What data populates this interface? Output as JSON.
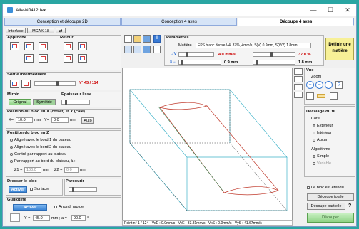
{
  "window": {
    "title": "Aile-NJ412.fex",
    "controls": [
      "—",
      "☐",
      "✕"
    ]
  },
  "tabs": [
    "Conception et découpe 2D",
    "Conception 4 axes",
    "Découpe 4 axes"
  ],
  "interface": {
    "label": "Interface",
    "machine": "MCAX-18"
  },
  "approche": {
    "title": "Approche"
  },
  "retour": {
    "title": "Retour"
  },
  "sortie": {
    "title": "Sortie intermédiaire",
    "value": "N° 45 / 114"
  },
  "miroir": {
    "title": "Miroir",
    "original": "Original",
    "symetrie": "Symétrie"
  },
  "epaisseur": {
    "title": "Épaisseur lisse"
  },
  "position_xy": {
    "title": "Position du bloc en X (offset) et Y (cale)",
    "x_label": "X=",
    "x_value": "10.0",
    "x_unit": "mm",
    "y_label": "Y=",
    "y_value": "0.0",
    "y_unit": "mm",
    "auto": "Auto"
  },
  "position_z": {
    "title": "Position du bloc en Z",
    "options": [
      "Aligné avec le bord 1 du plateau",
      "Aligné avec le bord 2 du plateau",
      "Centré par rapport au plateau",
      "Par rapport au bord du plateau, à :"
    ],
    "z1_label": "Z1 =",
    "z1_value": "100.0",
    "z2_label": "Z2 =",
    "z2_value": "0.0",
    "unit": "mm"
  },
  "dresser": {
    "title": "Dresser le bloc",
    "activer": "Activer",
    "surfacer": "Surfacer"
  },
  "parcourir": {
    "title": "Parcourir"
  },
  "guillotine": {
    "title": "Guillotine",
    "activer": "Activer",
    "arrondi": "Arrondi rapide",
    "y_label": "Y =",
    "y_value": "45.0",
    "a_label": "mm ; a =",
    "a_value": "90.0",
    "deg": "°"
  },
  "parametres": {
    "title": "Paramètres",
    "matiere_label": "Matière",
    "matiere_value": "EPS blanc dense V4, 37%, 4mm/s, S(V) 0.9mm, S(V/2) 1.8mm",
    "speed_value": "4.0 mm/s",
    "speed_pct": "37.0 %",
    "s1_value": "0.9 mm",
    "s2_value": "1.8 mm"
  },
  "definir": "Définir une matière",
  "vue": {
    "title": "Vue",
    "zoom": "Zoom"
  },
  "decalage": {
    "title": "Décalage du fil",
    "cote": "Côté",
    "options": [
      "Extérieur",
      "Intérieur",
      "Aucun"
    ],
    "algo": "Algorithme",
    "algo_options": [
      "Simple",
      "Variable"
    ]
  },
  "etendu": "Le bloc est étendu",
  "decoupe_totale": "Découpe totale",
  "decoupe_partielle": "Découpe partielle",
  "help": "?",
  "decouper": "Découper",
  "status": "Point n° 1 / 124 - VxE : 0.0mm/s - VyE : 33.81mm/s - VxS : 0.0mm/s - VyS : 41.67mm/s"
}
